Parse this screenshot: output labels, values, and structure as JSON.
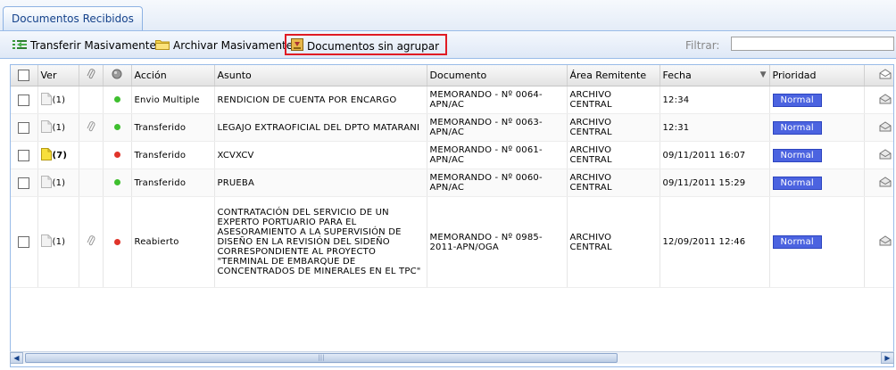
{
  "tabs": [
    {
      "label": "Documentos Recibidos",
      "active": true
    }
  ],
  "toolbar": {
    "transfer_label": "Transferir Masivamente",
    "archive_label": "Archivar Masivamente",
    "sinagrupar_label": "Documentos sin agrupar",
    "filter_label": "Filtrar:",
    "filter_value": ""
  },
  "columns": {
    "ver": "Ver",
    "accion": "Acción",
    "asunto": "Asunto",
    "documento": "Documento",
    "area": "Área Remitente",
    "fecha": "Fecha",
    "prioridad": "Prioridad"
  },
  "icons": {
    "transfer": "transfer-icon",
    "archive": "folder-icon",
    "sinagrupar": "ungroup-icon",
    "attach_header": "paperclip-icon",
    "status_header": "status-icon",
    "mail_header": "mail-icon",
    "doc": "document-icon",
    "doc_unread": "document-yellow-icon",
    "attachment": "paperclip-icon",
    "row_mail": "envelope-open-icon"
  },
  "colors": {
    "status_green": "#3fbf2f",
    "status_red": "#e0342a",
    "priority_bg": "#4b63e0",
    "highlight_border": "#e01b24"
  },
  "rows": [
    {
      "count": "(1)",
      "unread": false,
      "attachment": false,
      "status": "green",
      "accion": "Envio Multiple",
      "asunto": "RENDICION DE CUENTA POR ENCARGO",
      "documento": "MEMORANDO - Nº 0064-APN/AC",
      "area": "ARCHIVO CENTRAL",
      "fecha": "12:34",
      "prioridad": "Normal"
    },
    {
      "count": "(1)",
      "unread": false,
      "attachment": true,
      "status": "green",
      "accion": "Transferido",
      "asunto": "LEGAJO EXTRAOFICIAL DEL DPTO MATARANI",
      "documento": "MEMORANDO - Nº 0063-APN/AC",
      "area": "ARCHIVO CENTRAL",
      "fecha": "12:31",
      "prioridad": "Normal"
    },
    {
      "count": "(7)",
      "unread": true,
      "attachment": false,
      "status": "red",
      "accion": "Transferido",
      "asunto": "XCVXCV",
      "documento": "MEMORANDO - Nº 0061-APN/AC",
      "area": "ARCHIVO CENTRAL",
      "fecha": "09/11/2011 16:07",
      "prioridad": "Normal"
    },
    {
      "count": "(1)",
      "unread": false,
      "attachment": false,
      "status": "green",
      "accion": "Transferido",
      "asunto": "PRUEBA",
      "documento": "MEMORANDO - Nº 0060-APN/AC",
      "area": "ARCHIVO CENTRAL",
      "fecha": "09/11/2011 15:29",
      "prioridad": "Normal"
    },
    {
      "count": "(1)",
      "unread": false,
      "attachment": true,
      "status": "red",
      "accion": "Reabierto",
      "asunto": "CONTRATACIÓN DEL SERVICIO DE UN EXPERTO PORTUARIO PARA EL ASESORAMIENTO A LA SUPERVISIÓN DE DISEÑO EN LA REVISIÓN DEL SIDEÑO CORRESPONDIENTE AL PROYECTO \"TERMINAL DE EMBARQUE DE CONCENTRADOS DE MINERALES EN EL TPC\"",
      "documento": "MEMORANDO - Nº 0985-2011-APN/OGA",
      "area": "ARCHIVO CENTRAL",
      "fecha": "12/09/2011 12:46",
      "prioridad": "Normal"
    }
  ]
}
